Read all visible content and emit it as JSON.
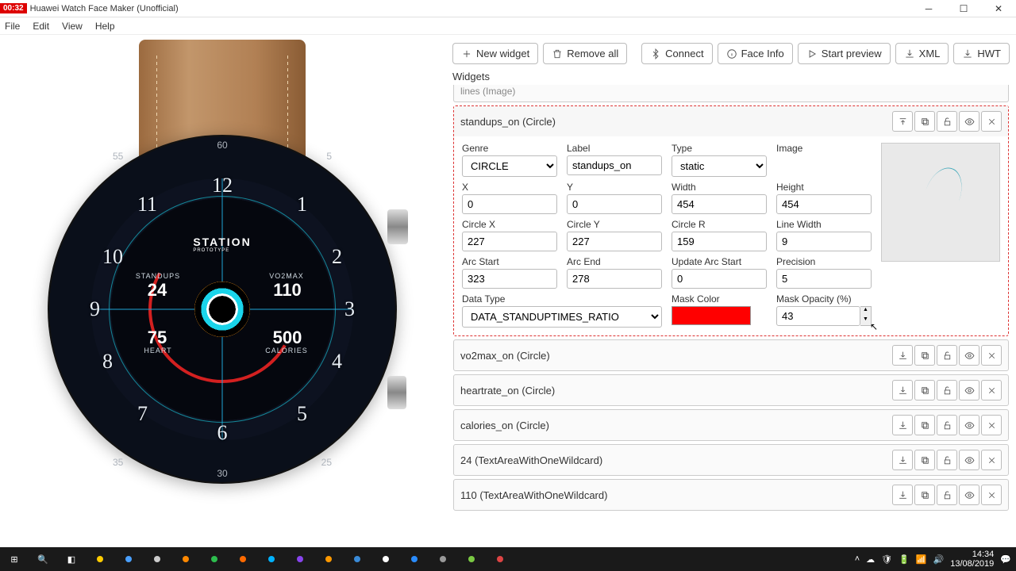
{
  "window": {
    "rec": "00:32",
    "title": "Huawei Watch Face Maker (Unofficial)"
  },
  "menu": {
    "file": "File",
    "edit": "Edit",
    "view": "View",
    "help": "Help"
  },
  "toolbar": {
    "new_widget": "New widget",
    "remove_all": "Remove all",
    "connect": "Connect",
    "face_info": "Face Info",
    "start_preview": "Start preview",
    "xml": "XML",
    "hwt": "HWT"
  },
  "panel": {
    "widgets_label": "Widgets"
  },
  "widgets_above": {
    "name": "lines (Image)"
  },
  "expanded": {
    "name": "standups_on (Circle)",
    "labels": {
      "genre": "Genre",
      "label": "Label",
      "type": "Type",
      "image": "Image",
      "x": "X",
      "y": "Y",
      "width": "Width",
      "height": "Height",
      "cx": "Circle X",
      "cy": "Circle Y",
      "cr": "Circle R",
      "lw": "Line Width",
      "as": "Arc Start",
      "ae": "Arc End",
      "uas": "Update Arc Start",
      "prec": "Precision",
      "dt": "Data Type",
      "mc": "Mask Color",
      "mo": "Mask Opacity (%)"
    },
    "values": {
      "genre": "CIRCLE",
      "label": "standups_on",
      "type": "static",
      "x": "0",
      "y": "0",
      "width": "454",
      "height": "454",
      "cx": "227",
      "cy": "227",
      "cr": "159",
      "lw": "9",
      "as": "323",
      "ae": "278",
      "uas": "0",
      "prec": "5",
      "dt": "DATA_STANDUPTIMES_RATIO",
      "mc": "#ff0000",
      "mo": "43"
    }
  },
  "widgets_below": [
    {
      "name": "vo2max_on (Circle)"
    },
    {
      "name": "heartrate_on (Circle)"
    },
    {
      "name": "calories_on (Circle)"
    },
    {
      "name": "24 (TextAreaWithOneWildcard)"
    },
    {
      "name": "110 (TextAreaWithOneWildcard)"
    }
  ],
  "dial": {
    "station": "STATION",
    "proto": "PROTOTYPE",
    "standups_l": "STANDUPS",
    "standups_v": "24",
    "vo2_l": "VO2MAX",
    "vo2_v": "110",
    "heart_l": "HEART",
    "heart_v": "75",
    "cal_l": "CALORIES",
    "cal_v": "500",
    "h12": "12",
    "h1": "1",
    "h2": "2",
    "h3": "3",
    "h4": "4",
    "h5": "5",
    "h6": "6",
    "h7": "7",
    "h8": "8",
    "h9": "9",
    "h10": "10",
    "h11": "11",
    "t60": "60",
    "t5": "5",
    "t55": "55",
    "t30": "30",
    "t25": "25",
    "t35": "35"
  },
  "taskbar": {
    "time": "14:34",
    "date": "13/08/2019"
  }
}
